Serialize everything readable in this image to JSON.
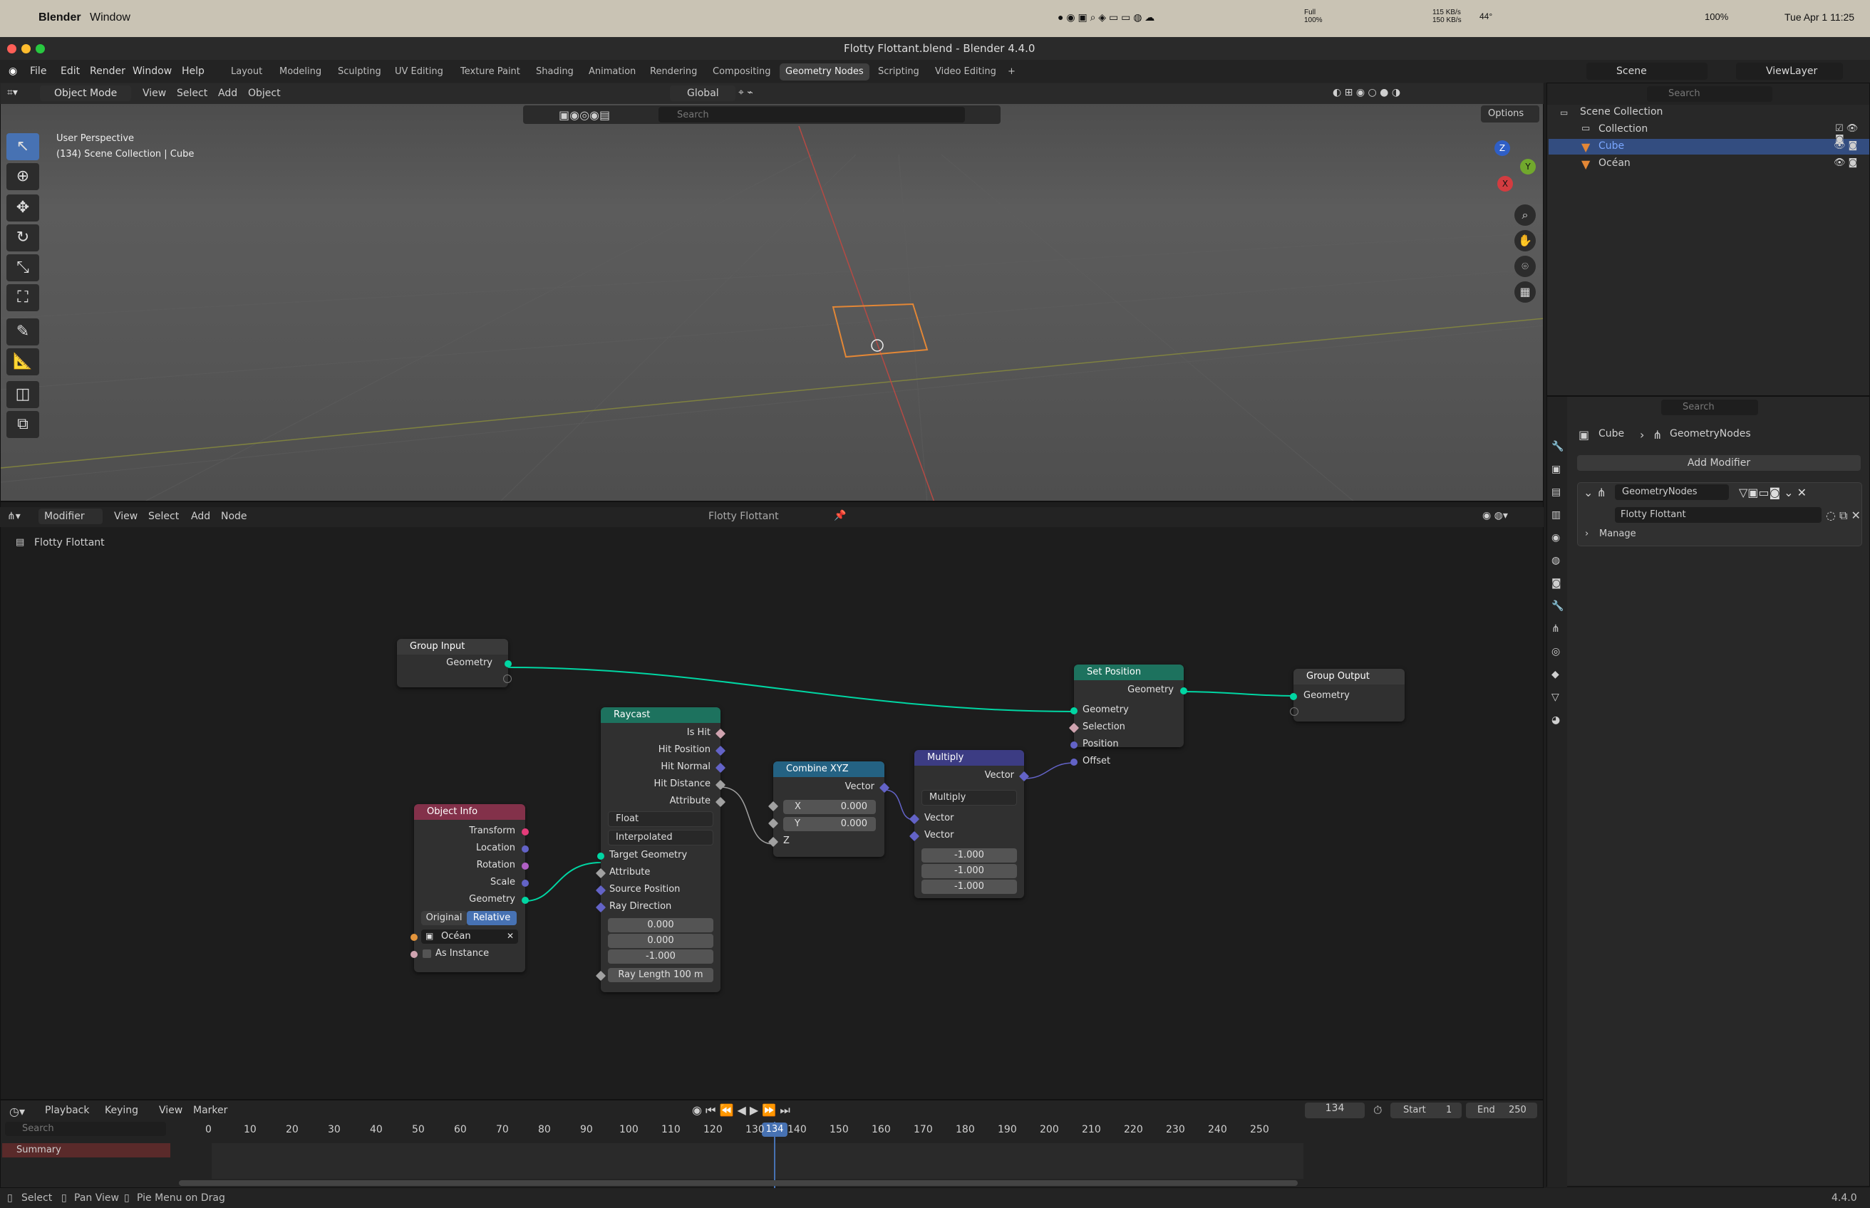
{
  "macbar": {
    "app": "Blender",
    "window_menu": "Window",
    "net_up": "115 KB/s",
    "net_down": "150 KB/s",
    "full_label": "Full",
    "full_pct": "100%",
    "temp": "44°",
    "battery": "100%",
    "datetime": "Tue Apr 1  11:25"
  },
  "window": {
    "title": "Flotty Flottant.blend - Blender 4.4.0"
  },
  "menus": [
    "File",
    "Edit",
    "Render",
    "Window",
    "Help"
  ],
  "workspaces": [
    {
      "label": "Layout"
    },
    {
      "label": "Modeling"
    },
    {
      "label": "Sculpting"
    },
    {
      "label": "UV Editing"
    },
    {
      "label": "Texture Paint"
    },
    {
      "label": "Shading"
    },
    {
      "label": "Animation"
    },
    {
      "label": "Rendering"
    },
    {
      "label": "Compositing"
    },
    {
      "label": "Geometry Nodes",
      "active": true
    },
    {
      "label": "Scripting"
    },
    {
      "label": "Video Editing"
    }
  ],
  "add_workspace": "+",
  "scene": {
    "label": "Scene",
    "viewlayer": "ViewLayer"
  },
  "viewport": {
    "mode": "Object Mode",
    "menus": [
      "View",
      "Select",
      "Add",
      "Object"
    ],
    "transform": "Global",
    "search_placeholder": "Search",
    "options": "Options",
    "overlay_line1": "User Perspective",
    "overlay_line2": "(134) Scene Collection | Cube",
    "gizmo": {
      "z": "Z",
      "y": "Y",
      "x": "X"
    }
  },
  "outliner": {
    "search_placeholder": "Search",
    "root": "Scene Collection",
    "items": [
      {
        "label": "Collection",
        "type": "collection"
      },
      {
        "label": "Cube",
        "type": "mesh",
        "selected": true
      },
      {
        "label": "Océan",
        "type": "mesh"
      }
    ]
  },
  "properties": {
    "search_placeholder": "Search",
    "breadcrumb_object": "Cube",
    "breadcrumb_modifier": "GeometryNodes",
    "add_modifier": "Add Modifier",
    "modifier_name": "GeometryNodes",
    "node_group": "Flotty Flottant",
    "manage": "Manage"
  },
  "node_editor": {
    "type": "Modifier",
    "menus": [
      "View",
      "Select",
      "Add",
      "Node"
    ],
    "tree_name": "Flotty Flottant",
    "breadcrumb": "Flotty Flottant"
  },
  "nodes": {
    "group_input": {
      "title": "Group Input",
      "outputs": [
        "Geometry"
      ]
    },
    "group_output": {
      "title": "Group Output",
      "inputs": [
        "Geometry"
      ]
    },
    "set_position": {
      "title": "Set Position",
      "output": "Geometry",
      "inputs": [
        "Geometry",
        "Selection",
        "Position",
        "Offset"
      ]
    },
    "raycast": {
      "title": "Raycast",
      "outputs": [
        "Is Hit",
        "Hit Position",
        "Hit Normal",
        "Hit Distance",
        "Attribute"
      ],
      "data_type": "Float",
      "mapping": "Interpolated",
      "inputs": [
        "Target Geometry",
        "Attribute",
        "Source Position",
        "Ray Direction"
      ],
      "ray_direction": [
        "0.000",
        "0.000",
        "-1.000"
      ],
      "ray_length_label": "Ray Length",
      "ray_length_value": "100 m"
    },
    "combine_xyz": {
      "title": "Combine XYZ",
      "output": "Vector",
      "x_label": "X",
      "x": "0.000",
      "y_label": "Y",
      "y": "0.000",
      "z_label": "Z"
    },
    "multiply": {
      "title": "Multiply",
      "output": "Vector",
      "operation": "Multiply",
      "inputs": [
        "Vector",
        "Vector"
      ],
      "values": [
        "-1.000",
        "-1.000",
        "-1.000"
      ]
    },
    "object_info": {
      "title": "Object Info",
      "outputs": [
        "Transform",
        "Location",
        "Rotation",
        "Scale",
        "Geometry"
      ],
      "mode_original": "Original",
      "mode_relative": "Relative",
      "object": "Océan",
      "as_instance": "As Instance"
    }
  },
  "timeline": {
    "menus": [
      "Playback",
      "Keying",
      "View",
      "Marker"
    ],
    "current_frame": "134",
    "start_label": "Start",
    "start": "1",
    "end_label": "End",
    "end": "250",
    "search_placeholder": "Search",
    "summary": "Summary",
    "ticks": [
      "0",
      "10",
      "20",
      "30",
      "40",
      "50",
      "60",
      "70",
      "80",
      "90",
      "100",
      "110",
      "120",
      "130",
      "140",
      "150",
      "160",
      "170",
      "180",
      "190",
      "200",
      "210",
      "220",
      "230",
      "240",
      "250"
    ]
  },
  "status": {
    "select": "Select",
    "pan": "Pan View",
    "pie": "Pie Menu on Drag",
    "version": "4.4.0"
  },
  "colors": {
    "accent": "#4772b3",
    "geometry_socket": "#00d6a3",
    "vector_socket": "#6363c7",
    "float_socket": "#a1a1a1",
    "matrix_socket": "#e43c7a",
    "header_geometry": "#1d725e",
    "header_converter": "#246283",
    "header_vector": "#3c3c83",
    "header_input": "#83314a"
  }
}
